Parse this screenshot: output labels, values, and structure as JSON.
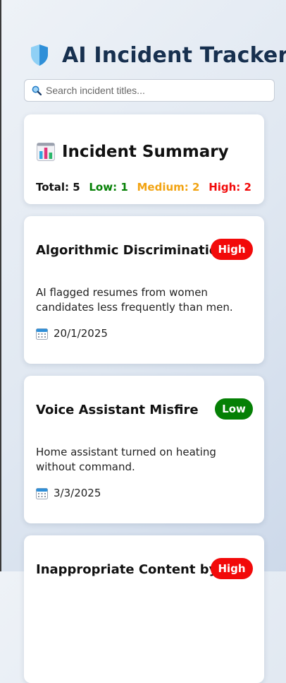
{
  "header": {
    "title": "AI Incident Tracker",
    "icon": "shield-icon"
  },
  "search": {
    "placeholder": "Search incident titles...",
    "value": "",
    "icon": "search-icon"
  },
  "summary": {
    "title": "Incident Summary",
    "icon": "bar-chart-icon",
    "total_label": "Total: 5",
    "low_label": "Low: 1",
    "medium_label": "Medium: 2",
    "high_label": "High: 2"
  },
  "incidents": [
    {
      "title": "Algorithmic Discrimination",
      "severity": "High",
      "description": "AI flagged resumes from women candidates less frequently than men.",
      "date": "20/1/2025"
    },
    {
      "title": "Voice Assistant Misfire",
      "severity": "Low",
      "description": "Home assistant turned on heating without command.",
      "date": "3/3/2025"
    },
    {
      "title": "Inappropriate Content by",
      "severity": "High",
      "description": "",
      "date": ""
    }
  ],
  "colors": {
    "title": "#17304f",
    "low": "#058005",
    "medium": "#f2a311",
    "high": "#f20a0a",
    "total": "#111111"
  }
}
